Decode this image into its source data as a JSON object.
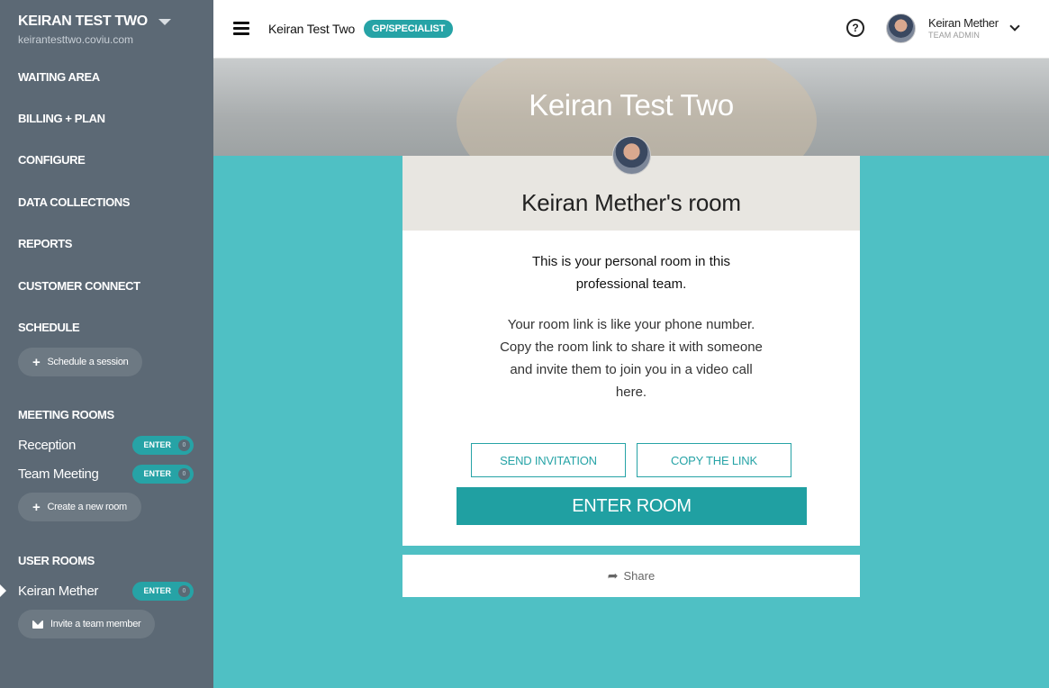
{
  "sidebar": {
    "team_name": "KEIRAN TEST TWO",
    "team_url": "keirantesttwo.coviu.com",
    "nav": [
      "WAITING AREA",
      "BILLING + PLAN",
      "CONFIGURE",
      "DATA COLLECTIONS",
      "REPORTS",
      "CUSTOMER CONNECT",
      "SCHEDULE"
    ],
    "schedule_button": "Schedule a session",
    "meeting_rooms_title": "MEETING ROOMS",
    "meeting_rooms": [
      {
        "name": "Reception",
        "enter": "ENTER",
        "count": "0"
      },
      {
        "name": "Team Meeting",
        "enter": "ENTER",
        "count": "0"
      }
    ],
    "create_room_button": "Create a new room",
    "user_rooms_title": "USER ROOMS",
    "user_rooms": [
      {
        "name": "Keiran Mether",
        "enter": "ENTER",
        "count": "0"
      }
    ],
    "invite_button": "Invite a team member"
  },
  "topbar": {
    "team_name": "Keiran Test Two",
    "specialty": "GP/SPECIALIST",
    "help": "?",
    "user_name": "Keiran Mether",
    "user_role": "TEAM ADMIN"
  },
  "hero": {
    "title": "Keiran Test Two"
  },
  "room": {
    "title": "Keiran Mether's room",
    "personal_text": "This is your personal room in this professional team.",
    "description": "Your room link is like your phone number. Copy the room link to share it with someone and invite them to join you in a video call here.",
    "send_invitation": "SEND INVITATION",
    "copy_link": "COPY THE LINK",
    "enter_room": "ENTER ROOM",
    "share": "Share"
  },
  "colors": {
    "accent": "#26a3a6",
    "sidebar": "#5c6975",
    "background": "#4fc0c4"
  }
}
